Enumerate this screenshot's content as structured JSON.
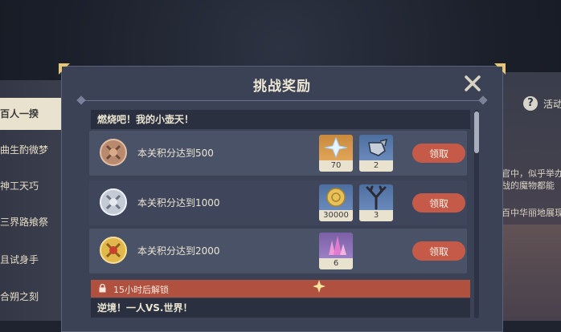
{
  "left_nav": {
    "items": [
      "百人一揆",
      "曲生酌微梦",
      "神工天巧",
      "三界路飨祭",
      "且试身手",
      "合朔之刻"
    ],
    "active_index": 0
  },
  "right_info": {
    "help_label": "活动",
    "lines": [
      "官中，似乎举办",
      "战的魔物都能",
      "百中华丽地展现"
    ]
  },
  "dialog": {
    "title": "挑战奖励",
    "close_icon": "close-icon",
    "section1": "燃烧吧！我的小壶天！",
    "rows": [
      {
        "medal": "bronze-medal-icon",
        "label": "本关积分达到500",
        "items": [
          {
            "icon": "primogem-icon",
            "count": "70",
            "rarity": "orange"
          },
          {
            "icon": "mora-bag-icon",
            "count": "2",
            "rarity": "blue"
          }
        ],
        "claim": "领取"
      },
      {
        "medal": "silver-medal-icon",
        "label": "本关积分达到1000",
        "items": [
          {
            "icon": "mora-icon",
            "count": "30000",
            "rarity": "blue"
          },
          {
            "icon": "coral-icon",
            "count": "3",
            "rarity": "blue"
          }
        ],
        "claim": "领取"
      },
      {
        "medal": "gold-medal-icon",
        "label": "本关积分达到2000",
        "items": [
          {
            "icon": "crystal-icon",
            "count": "6",
            "rarity": "purple"
          }
        ],
        "claim": "领取"
      }
    ],
    "lock_text": "15小时后解锁",
    "section2": "逆境！一人VS.世界！"
  },
  "colors": {
    "claim_button": "#c65a48",
    "lock_bar": "#b0503f",
    "panel": "#3b4256"
  }
}
